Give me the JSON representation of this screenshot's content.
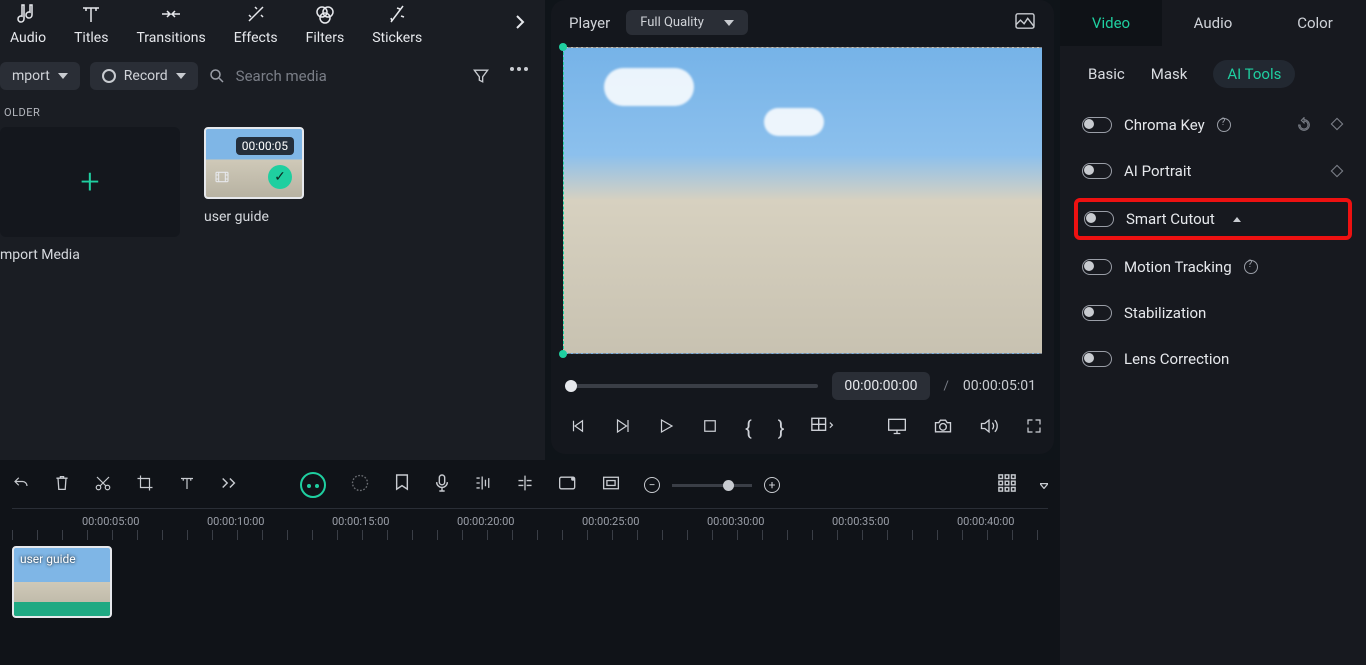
{
  "toolbar": {
    "items": [
      "Audio",
      "Titles",
      "Transitions",
      "Effects",
      "Filters",
      "Stickers"
    ]
  },
  "controls": {
    "import": "mport",
    "record": "Record",
    "search_placeholder": "Search media"
  },
  "media": {
    "section": "OLDER",
    "import_caption": "mport Media",
    "clip_caption": "user guide",
    "clip_duration": "00:00:05"
  },
  "player": {
    "label": "Player",
    "quality": "Full Quality",
    "current": "00:00:00:00",
    "total": "00:00:05:01",
    "slash": "/"
  },
  "right": {
    "tabs": [
      "Video",
      "Audio",
      "Color"
    ],
    "subtabs": [
      "Basic",
      "Mask",
      "AI Tools"
    ],
    "options": {
      "chroma": "Chroma Key",
      "portrait": "AI Portrait",
      "cutout": "Smart Cutout",
      "motion": "Motion Tracking",
      "stab": "Stabilization",
      "lens": "Lens Correction"
    }
  },
  "timeline": {
    "stamps": [
      "00:00:05:00",
      "00:00:10:00",
      "00:00:15:00",
      "00:00:20:00",
      "00:00:25:00",
      "00:00:30:00",
      "00:00:35:00",
      "00:00:40:00"
    ],
    "clip_name": "user guide"
  }
}
